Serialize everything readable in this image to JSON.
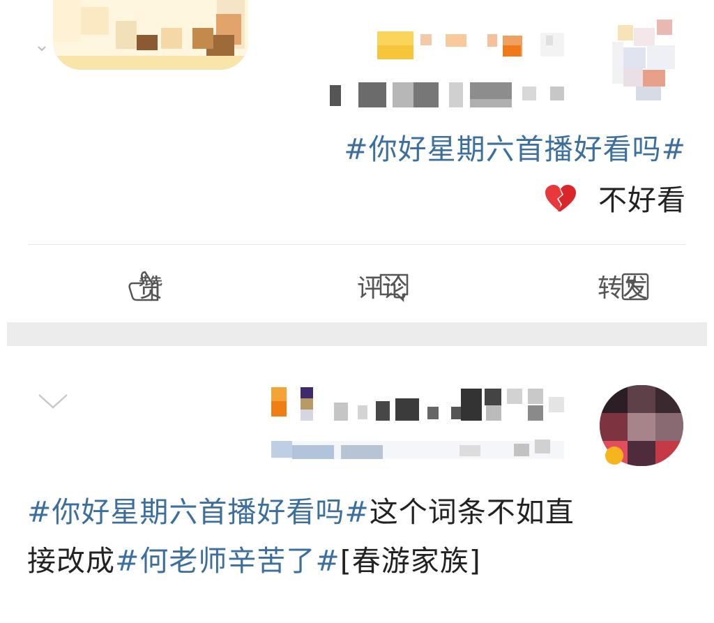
{
  "post1": {
    "hashtag": "#你好星期六首播好看吗#",
    "comment": "不好看",
    "comment_emoji": "broken-heart-icon"
  },
  "actions": {
    "repost": "转发",
    "comment": "评论",
    "like": "赞"
  },
  "post2": {
    "hashtag1": "#你好星期六首播好看吗#",
    "text1": "这个词条不如直",
    "text2": "接改成",
    "hashtag2": "#何老师辛苦了#",
    "text3": "[春游家族]"
  },
  "colors": {
    "hashtag": "#3c6f9e",
    "text": "#222222",
    "action": "#555555",
    "separator": "#ececec"
  }
}
